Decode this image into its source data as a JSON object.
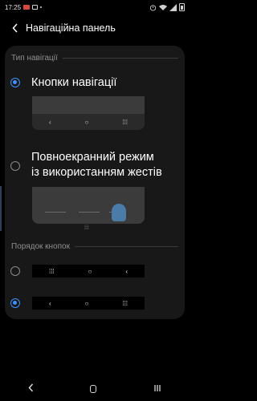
{
  "status_bar": {
    "time": "17:25"
  },
  "header": {
    "back_icon": "chevron-left-icon",
    "title": "Навігаційна панель"
  },
  "sections": {
    "nav_type": "Тип навігації",
    "button_order": "Порядок кнопок"
  },
  "options": {
    "buttons": {
      "label": "Кнопки навігації",
      "selected": true
    },
    "gestures": {
      "label_line1": "Повноекранний режим",
      "label_line2": "із використанням жестів",
      "selected": false
    }
  },
  "preview_glyphs": {
    "back": "‹",
    "home": "○",
    "recents": "⁞⁞⁞"
  },
  "order_options": [
    {
      "selected": false,
      "left": "⁞⁞⁞",
      "mid": "○",
      "right": "‹"
    },
    {
      "selected": true,
      "left": "‹",
      "mid": "○",
      "right": "⁞⁞⁞"
    }
  ],
  "colors": {
    "accent": "#3e91ff",
    "card": "#181818",
    "background": "#000000"
  }
}
